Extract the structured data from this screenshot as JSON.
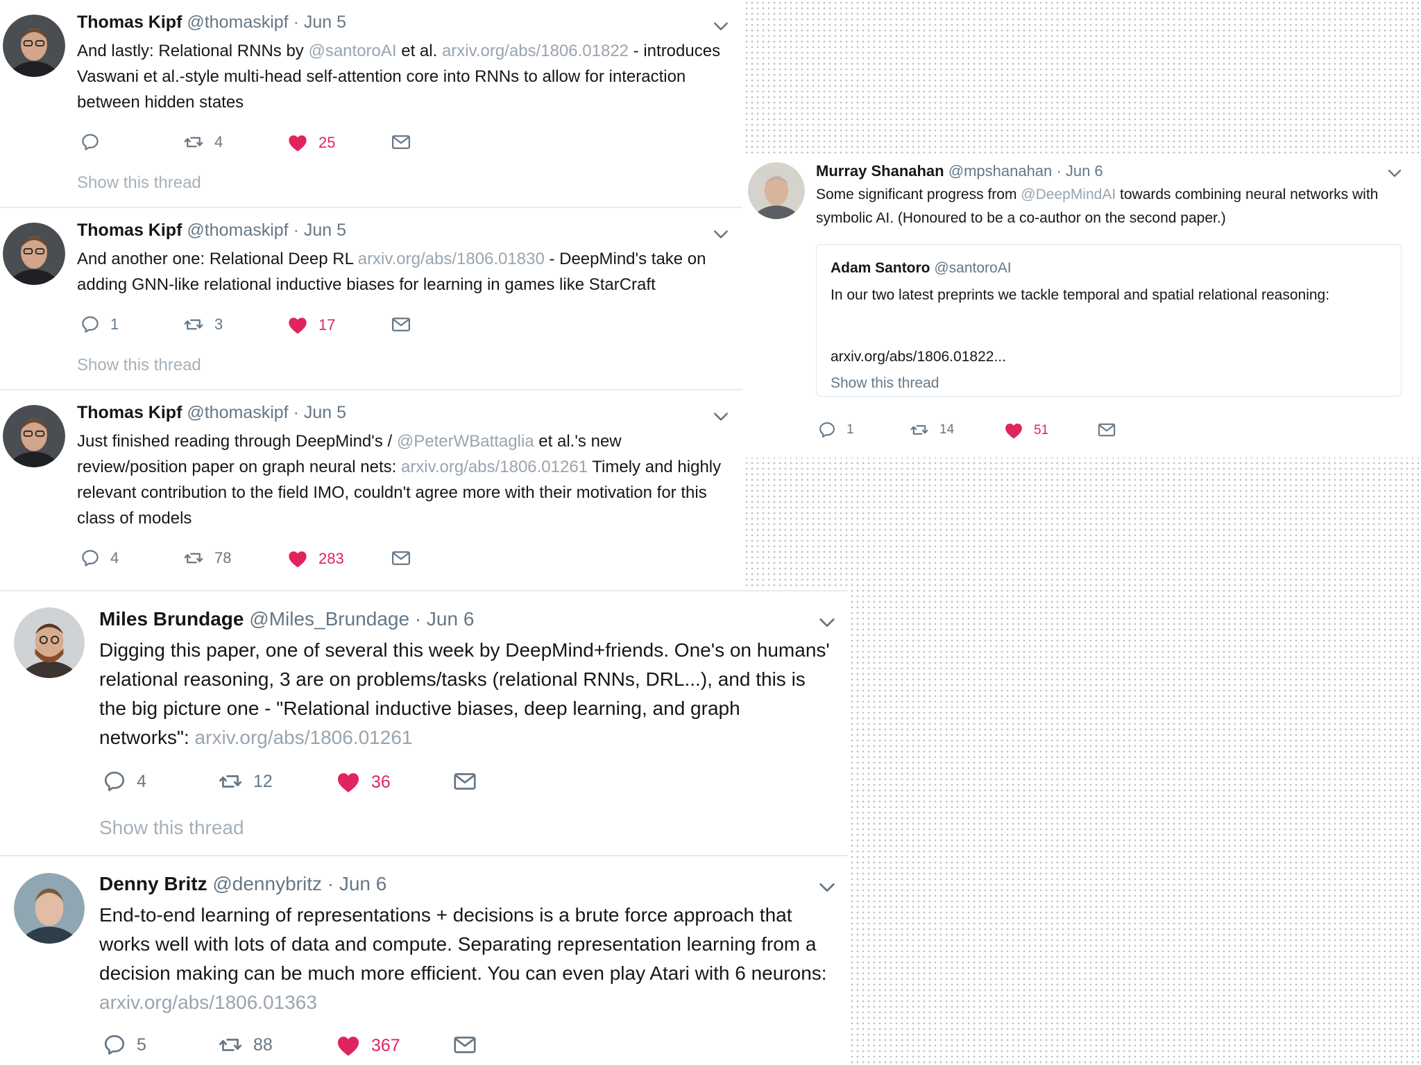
{
  "colors": {
    "link": "#99a4ae",
    "like": "#e0245e",
    "muted": "#657786"
  },
  "tweets": [
    {
      "name": "Thomas Kipf",
      "handle": "@thomaskipf",
      "date": "· Jun 5",
      "t1": "And lastly: Relational RNNs by ",
      "l1": "@santoroAI",
      "t2": " et al. ",
      "l2": "arxiv.org/abs/1806.01822",
      "t3": " - introduces Vaswani et al.-style multi-head self-attention core into RNNs to allow for interaction between hidden states",
      "reply_count": "",
      "retweet_count": "4",
      "like_count": "25",
      "show_thread": "Show this thread"
    },
    {
      "name": "Thomas Kipf",
      "handle": "@thomaskipf",
      "date": "· Jun 5",
      "t1": "And another one: Relational Deep RL ",
      "l1": "arxiv.org/abs/1806.01830",
      "t2": " - DeepMind's take on adding GNN-like relational inductive biases for learning in games like StarCraft",
      "reply_count": "1",
      "retweet_count": "3",
      "like_count": "17",
      "show_thread": "Show this thread"
    },
    {
      "name": "Thomas Kipf",
      "handle": "@thomaskipf",
      "date": "· Jun 5",
      "t1": "Just finished reading through DeepMind's / ",
      "l1": "@PeterWBattaglia",
      "t2": " et al.'s new review/position paper on graph neural nets: ",
      "l2": "arxiv.org/abs/1806.01261",
      "t3": " Timely and highly relevant contribution to the field IMO, couldn't agree more with their motivation for this class of models",
      "reply_count": "4",
      "retweet_count": "78",
      "like_count": "283"
    },
    {
      "name": "Miles Brundage",
      "handle": "@Miles_Brundage",
      "date": "· Jun 6",
      "t1": "Digging this paper, one of several this week by DeepMind+friends. One's on humans' relational reasoning, 3 are on problems/tasks (relational RNNs, DRL...), and this is the big picture one - \"Relational inductive biases, deep learning, and graph networks\": ",
      "l1": "arxiv.org/abs/1806.01261",
      "reply_count": "4",
      "retweet_count": "12",
      "like_count": "36",
      "show_thread": "Show this thread"
    },
    {
      "name": "Denny Britz",
      "handle": "@dennybritz",
      "date": "· Jun 6",
      "t1": "End-to-end learning of representations + decisions is a brute force approach that works well with lots of data and compute. Separating representation learning from a decision making can be much more efficient. You can even play Atari with 6 neurons: ",
      "l1": "arxiv.org/abs/1806.01363",
      "reply_count": "5",
      "retweet_count": "88",
      "like_count": "367"
    },
    {
      "name": "Murray Shanahan",
      "handle": "@mpshanahan",
      "date": "· Jun 6",
      "t1": "Some significant progress from ",
      "l1": "@DeepMindAI",
      "t2": " towards combining neural networks with symbolic AI. (Honoured to be a co-author on the second paper.)",
      "quote": {
        "name": "Adam Santoro",
        "handle": "@santoroAI",
        "text": "In our two latest preprints we tackle temporal and spatial relational reasoning:",
        "link": "arxiv.org/abs/1806.01822...",
        "show_thread": "Show this thread"
      },
      "reply_count": "1",
      "retweet_count": "14",
      "like_count": "51"
    }
  ]
}
